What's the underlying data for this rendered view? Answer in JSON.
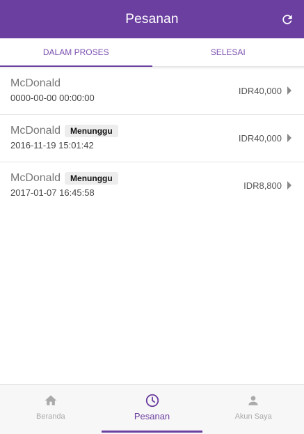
{
  "header": {
    "title": "Pesanan",
    "refresh_icon": "refresh-icon"
  },
  "tabs": [
    {
      "label": "DALAM PROSES",
      "active": true
    },
    {
      "label": "SELESAI",
      "active": false
    }
  ],
  "orders": [
    {
      "merchant": "McDonald",
      "status": "",
      "date": "0000-00-00 00:00:00",
      "price": "IDR40,000"
    },
    {
      "merchant": "McDonald",
      "status": "Menunggu",
      "date": "2016-11-19 15:01:42",
      "price": "IDR40,000"
    },
    {
      "merchant": "McDonald",
      "status": "Menunggu",
      "date": "2017-01-07 16:45:58",
      "price": "IDR8,800"
    }
  ],
  "bottom_nav": [
    {
      "label": "Beranda",
      "icon": "home-icon",
      "active": false
    },
    {
      "label": "Pesanan",
      "icon": "clock-icon",
      "active": true
    },
    {
      "label": "Akun Saya",
      "icon": "user-icon",
      "active": false
    }
  ],
  "colors": {
    "brand": "#6b3fa0",
    "nav_inactive": "#aaaaaa",
    "badge_bg": "#ededed"
  }
}
